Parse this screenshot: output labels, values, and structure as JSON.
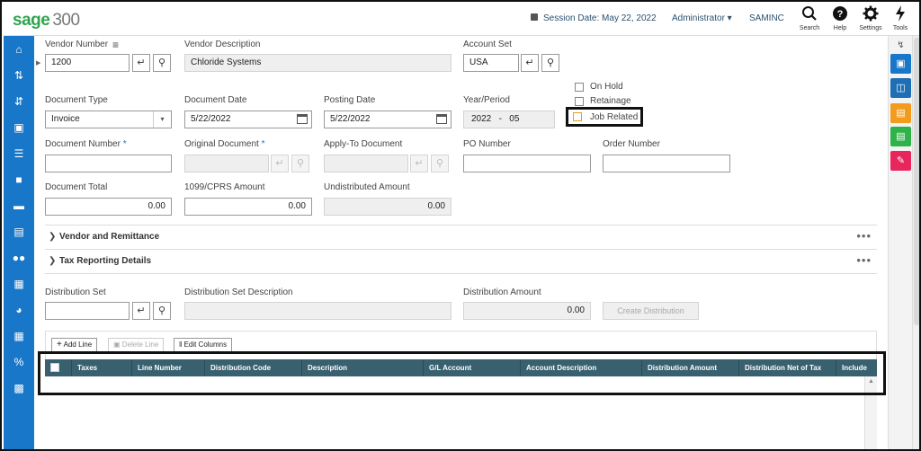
{
  "app": {
    "brand": "sage",
    "version": "300"
  },
  "header": {
    "session_label": "Session Date:",
    "session_date": "May 22, 2022",
    "user": "Administrator",
    "company": "SAMINC",
    "tools": [
      {
        "label": "Search",
        "icon": "search-icon"
      },
      {
        "label": "Help",
        "icon": "help-icon"
      },
      {
        "label": "Settings",
        "icon": "gear-icon"
      },
      {
        "label": "Tools",
        "icon": "lightning-icon"
      }
    ]
  },
  "form": {
    "vendor_number": {
      "label": "Vendor Number",
      "value": "1200"
    },
    "vendor_description": {
      "label": "Vendor Description",
      "value": "Chloride Systems"
    },
    "account_set": {
      "label": "Account Set",
      "value": "USA"
    },
    "document_type": {
      "label": "Document Type",
      "value": "Invoice"
    },
    "document_date": {
      "label": "Document Date",
      "value": "5/22/2022"
    },
    "posting_date": {
      "label": "Posting Date",
      "value": "5/22/2022"
    },
    "year_period": {
      "label": "Year/Period",
      "year": "2022",
      "sep": "-",
      "period": "05"
    },
    "on_hold": {
      "label": "On Hold",
      "checked": false
    },
    "retainage": {
      "label": "Retainage",
      "checked": false
    },
    "job_related": {
      "label": "Job Related",
      "checked": false
    },
    "document_number": {
      "label": "Document Number",
      "required": "*",
      "value": ""
    },
    "original_document": {
      "label": "Original Document",
      "required": "*",
      "value": ""
    },
    "apply_to_document": {
      "label": "Apply-To Document",
      "value": ""
    },
    "po_number": {
      "label": "PO Number",
      "value": ""
    },
    "order_number": {
      "label": "Order Number",
      "value": ""
    },
    "document_total": {
      "label": "Document Total",
      "value": "0.00"
    },
    "cprs_amount": {
      "label": "1099/CPRS Amount",
      "value": "0.00"
    },
    "undistributed_amount": {
      "label": "Undistributed Amount",
      "value": "0.00"
    }
  },
  "sections": [
    {
      "title": "Vendor and Remittance"
    },
    {
      "title": "Tax Reporting Details"
    }
  ],
  "distribution": {
    "set_label": "Distribution Set",
    "set_value": "",
    "desc_label": "Distribution Set Description",
    "desc_value": "",
    "amount_label": "Distribution Amount",
    "amount_value": "0.00",
    "create_button": "Create Distribution"
  },
  "grid": {
    "add_line": "Add Line",
    "delete_line": "Delete Line",
    "edit_columns": "Edit Columns",
    "columns": [
      "Taxes",
      "Line Number",
      "Distribution Code",
      "Description",
      "G/L Account",
      "Account Description",
      "Distribution Amount",
      "Distribution Net of Tax",
      "Include"
    ]
  },
  "colors": {
    "sidebar": "#1877c9",
    "grid_header": "#38606f",
    "brand": "#2ea44f"
  }
}
